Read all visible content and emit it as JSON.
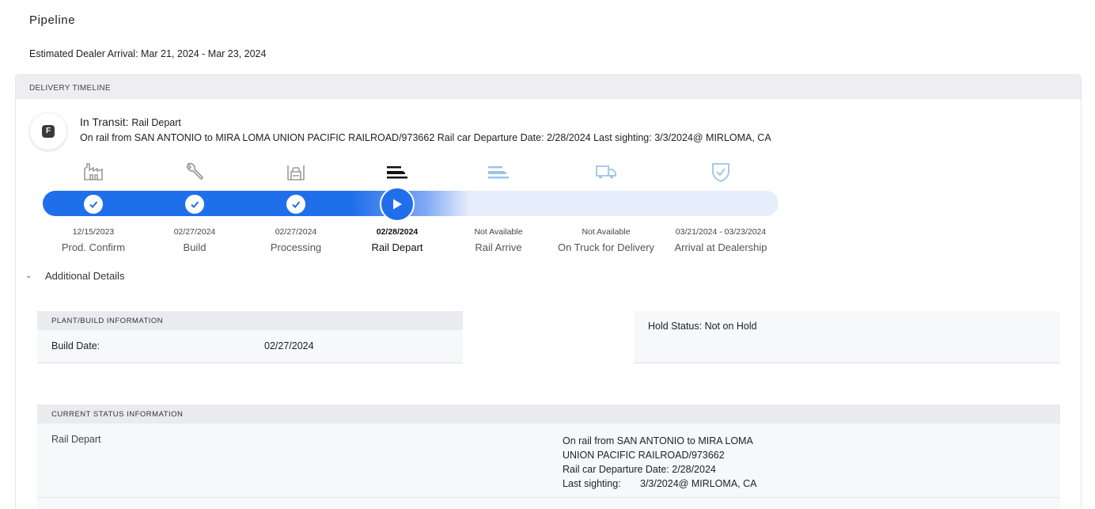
{
  "page": {
    "title": "Pipeline",
    "estimated_arrival": "Estimated Dealer Arrival: Mar 21, 2024 - Mar 23, 2024"
  },
  "timeline": {
    "header": "DELIVERY TIMELINE",
    "badge_letter": "F",
    "status_label": "In Transit:",
    "status_value": "Rail Depart",
    "status_description": "On rail from SAN ANTONIO to MIRA LOMA UNION PACIFIC RAILROAD/973662 Rail car Departure Date: 2/28/2024 Last sighting: 3/3/2024@ MIRLOMA, CA",
    "stages": [
      {
        "date": "12/15/2023",
        "label": "Prod. Confirm",
        "icon": "factory-icon",
        "state": "complete"
      },
      {
        "date": "02/27/2024",
        "label": "Build",
        "icon": "wrench-icon",
        "state": "complete"
      },
      {
        "date": "02/27/2024",
        "label": "Processing",
        "icon": "processing-icon",
        "state": "complete"
      },
      {
        "date": "02/28/2024",
        "label": "Rail Depart",
        "icon": "rail-car-icon",
        "state": "current"
      },
      {
        "date": "Not Available",
        "label": "Rail Arrive",
        "icon": "rail-car-icon",
        "state": "upcoming"
      },
      {
        "date": "Not Available",
        "label": "On Truck for Delivery",
        "icon": "truck-icon",
        "state": "upcoming"
      },
      {
        "date": "03/21/2024 - 03/23/2024",
        "label": "Arrival at Dealership",
        "icon": "shield-check-icon",
        "state": "upcoming"
      }
    ],
    "colors": {
      "progress": "#1f6fea",
      "track": "#e7eefb",
      "complete_icon": "#9a9a9a",
      "current_icon": "#111111",
      "upcoming_icon": "#9cc4ea"
    }
  },
  "details": {
    "toggle_label": "Additional Details",
    "plant": {
      "header": "PLANT/BUILD INFORMATION",
      "build_date_label": "Build Date:",
      "build_date_value": "02/27/2024"
    },
    "hold": {
      "text": "Hold Status: Not on Hold"
    },
    "current_status": {
      "header": "CURRENT STATUS INFORMATION",
      "status": "Rail Depart",
      "line1": "On rail from SAN ANTONIO to MIRA LOMA",
      "line2": "UNION PACIFIC RAILROAD/973662",
      "line3": "Rail car Departure Date: 2/28/2024",
      "sighting_label": "Last sighting:",
      "sighting_value": "3/3/2024@ MIRLOMA, CA"
    }
  }
}
